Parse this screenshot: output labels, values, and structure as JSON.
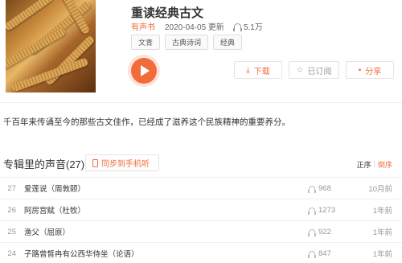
{
  "album": {
    "title": "重读经典古文",
    "source": "有声书",
    "updated": "2020-04-05 更新",
    "play_count": "5.1万",
    "tags": [
      "文青",
      "古典诗词",
      "经典"
    ],
    "intro": "千百年来传诵至今的那些古文佳作，已经成了滋养这个民族精神的重要养分。"
  },
  "actions": {
    "download": "下载",
    "subscribed": "已订阅",
    "share": "分享"
  },
  "tracks_section": {
    "title": "专辑里的声音(27)",
    "sync_label": "同步到手机听",
    "sort_asc": "正序",
    "sort_desc": "倒序"
  },
  "tracks": [
    {
      "num": "27",
      "name": "爱莲说（周敦颐）",
      "plays": "968",
      "time": "10月前"
    },
    {
      "num": "26",
      "name": "阿房宫赋（杜牧）",
      "plays": "1273",
      "time": "1年前"
    },
    {
      "num": "25",
      "name": "渔父（屈原）",
      "plays": "922",
      "time": "1年前"
    },
    {
      "num": "24",
      "name": "子路曾皙冉有公西华侍坐（论语）",
      "plays": "847",
      "time": "1年前"
    }
  ],
  "colors": {
    "accent": "#f26b3a"
  }
}
